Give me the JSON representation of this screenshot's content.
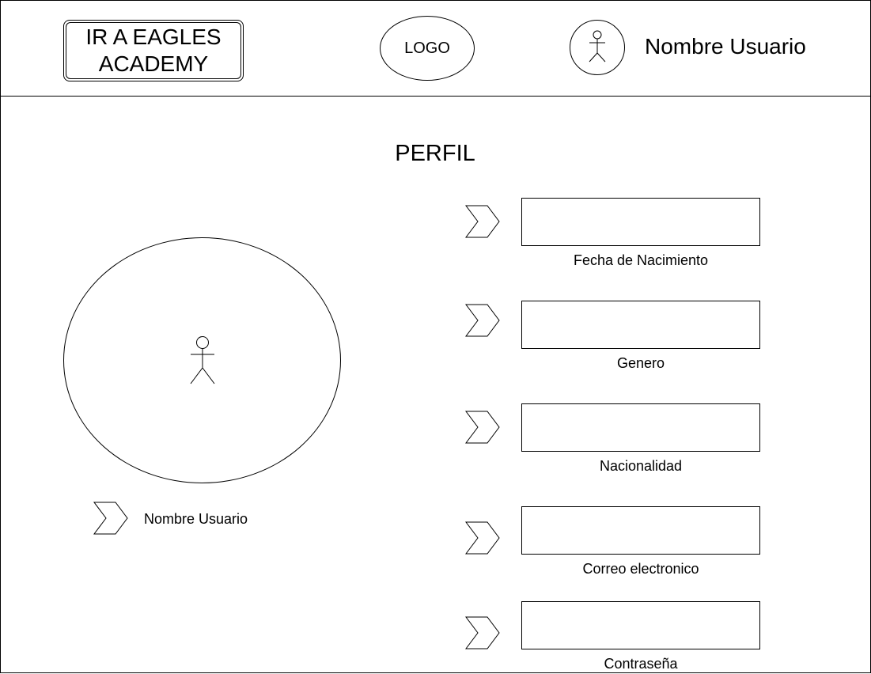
{
  "header": {
    "academy_button_label": "IR A EAGLES ACADEMY",
    "logo_text": "LOGO",
    "user_name": "Nombre Usuario"
  },
  "page": {
    "title": "PERFIL"
  },
  "profile": {
    "user_name": "Nombre Usuario"
  },
  "fields": [
    {
      "label": "Fecha de Nacimiento",
      "value": ""
    },
    {
      "label": "Genero",
      "value": ""
    },
    {
      "label": "Nacionalidad",
      "value": ""
    },
    {
      "label": "Correo electronico",
      "value": ""
    },
    {
      "label": "Contraseña",
      "value": ""
    }
  ],
  "icons": {
    "user": "person-icon",
    "pointer": "chevron-right-icon"
  }
}
